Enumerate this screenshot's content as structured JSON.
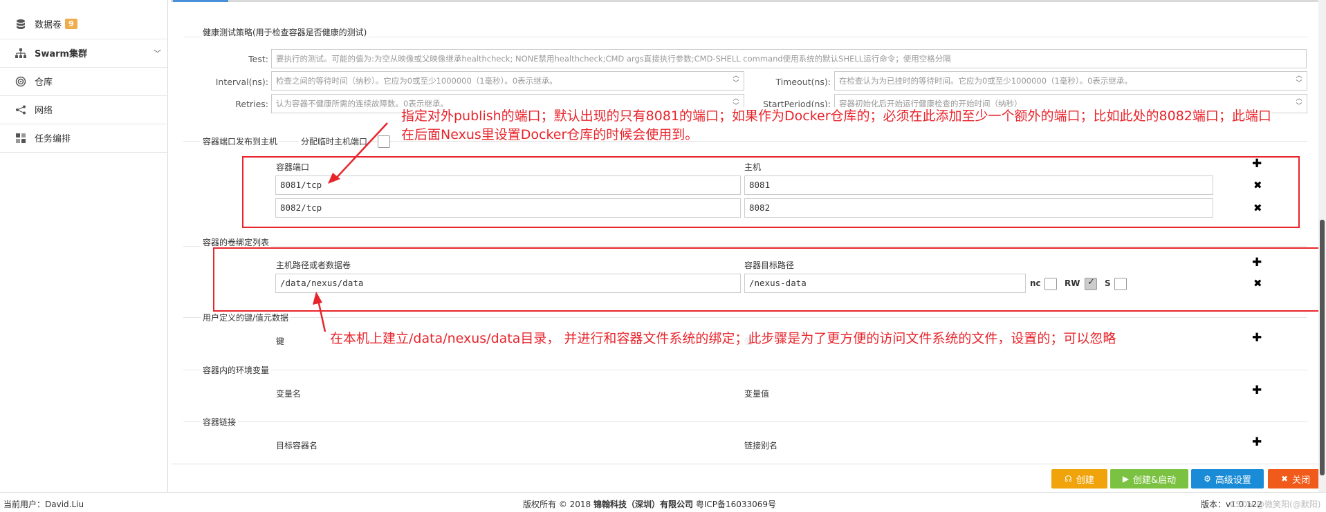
{
  "sidebar": {
    "items": [
      {
        "label": "数据卷",
        "badge": "9",
        "icon": "database-icon"
      },
      {
        "label": "Swarm集群",
        "icon": "sitemap-icon",
        "chevron": "﹀"
      },
      {
        "label": "仓库",
        "icon": "target-icon"
      },
      {
        "label": "网络",
        "icon": "share-icon"
      },
      {
        "label": "任务编排",
        "icon": "puzzle-icon"
      }
    ]
  },
  "healthcheck": {
    "title": "健康测试策略(用于检查容器是否健康的测试)",
    "test_label": "Test:",
    "test_placeholder": "要执行的测试。可能的值为:为空从映像或父映像继承healthcheck; NONE禁用healthcheck;CMD args直接执行参数;CMD-SHELL command使用系统的默认SHELL运行命令；使用空格分隔",
    "interval_label": "Interval(ns):",
    "interval_placeholder": "检查之间的等待时间（纳秒）。它应为0或至少1000000（1毫秒）。0表示继承。",
    "timeout_label": "Timeout(ns):",
    "timeout_placeholder": "在检查认为为已挂时的等待时间。它应为0或至少1000000（1毫秒）。0表示继承。",
    "retries_label": "Retries:",
    "retries_placeholder": "认为容器不健康所需的连续故障数。0表示继承。",
    "startperiod_label": "StartPeriod(ns):",
    "startperiod_placeholder": "容器初始化后开始运行健康检查的开始时间（纳秒）"
  },
  "ports": {
    "title": "容器端口发布到主机",
    "random_label": "分配临时主机端口",
    "col_container": "容器端口",
    "col_host": "主机",
    "rows": [
      {
        "container": "8081/tcp",
        "host": "8081"
      },
      {
        "container": "8082/tcp",
        "host": "8082"
      }
    ]
  },
  "volumes": {
    "title": "容器的卷绑定列表",
    "col_host": "主机路径或者数据卷",
    "col_container": "容器目标路径",
    "rows": [
      {
        "host": "/data/nexus/data",
        "container": "/nexus-data",
        "nc": "nc",
        "rw": "RW",
        "s": "S",
        "rw_checked": true
      }
    ]
  },
  "labels": {
    "title": "用户定义的键/值元数据",
    "col_key": "键"
  },
  "env": {
    "title": "容器内的环境变量",
    "col_name": "变量名",
    "col_value": "变量值"
  },
  "links": {
    "title": "容器链接",
    "col_target": "目标容器名",
    "col_alias": "链接别名"
  },
  "annotations": {
    "ports_line1": "指定对外publish的端口；默认出现的只有8081的端口；如果作为Docker仓库的；必须在此添加至少一个额外的端口；比如此处的8082端口；此端口",
    "ports_line2": "在后面Nexus里设置Docker仓库的时候会使用到。",
    "volume_note": "在本机上建立/data/nexus/data目录，  并进行和容器文件系统的绑定；此步骤是为了更方便的访问文件系统的文件，设置的；可以忽略",
    "color": "#e8242b"
  },
  "buttons": {
    "create": "创建",
    "create_start": "创建&启动",
    "advanced": "高级设置",
    "close": "关闭",
    "colors": {
      "create": "#f0a30a",
      "create_start": "#7cc242",
      "advanced": "#1a8bd6",
      "close": "#f05a1a"
    }
  },
  "footer": {
    "user": "当前用户：David.Liu",
    "copyright_prefix": "版权所有 © 2018 ",
    "company": "锦翰科技（深圳）有限公司",
    "icp": " 粤ICP备16033069号",
    "version_label": "版本：",
    "version_value": "v1.0.122",
    "watermark": "CSDN @微笑阳",
    "watermark_suffix": "(@默阳)"
  }
}
